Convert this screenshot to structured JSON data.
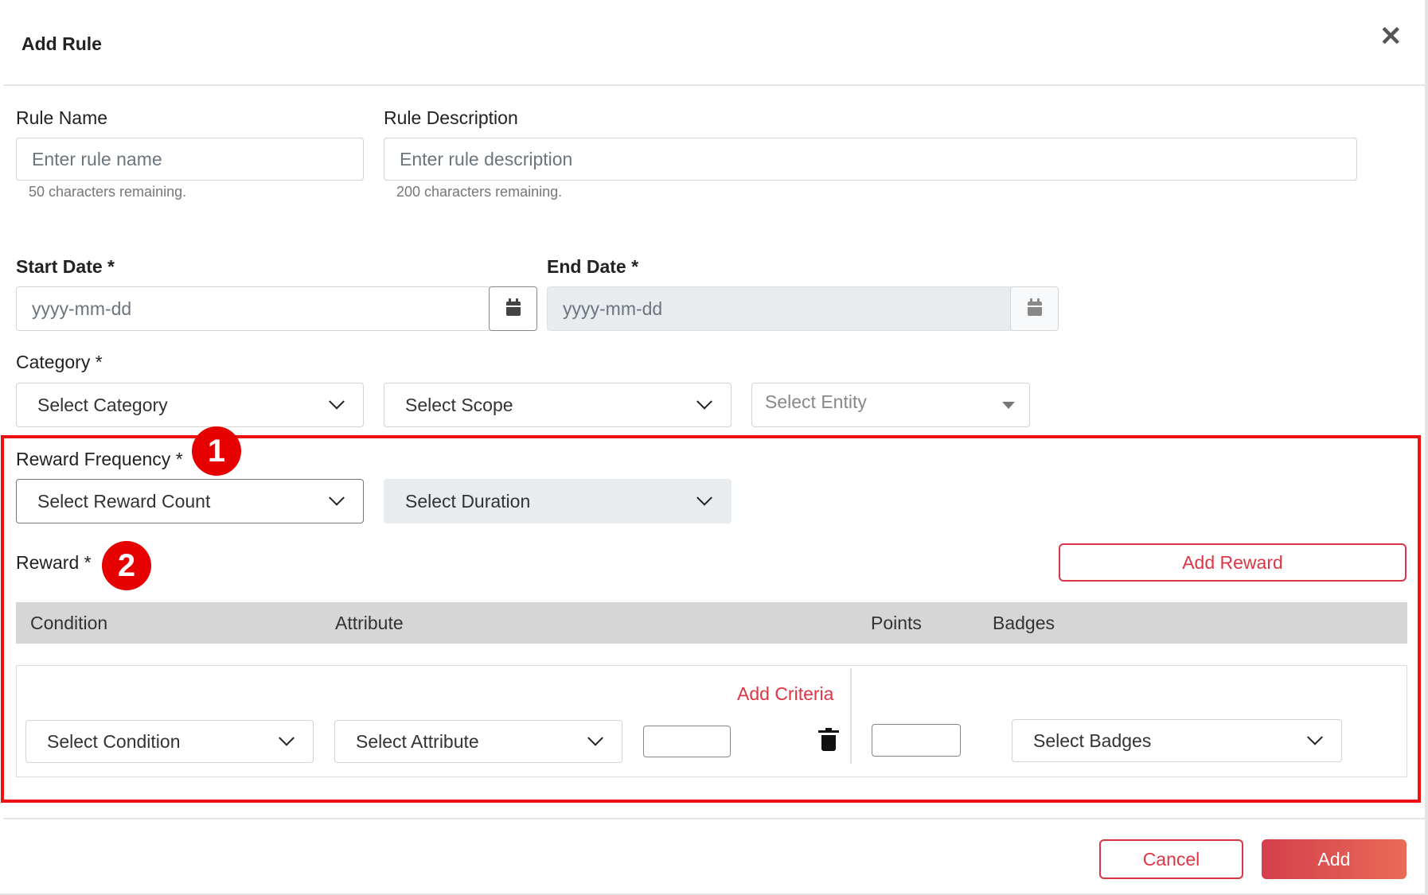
{
  "modal": {
    "title": "Add Rule"
  },
  "form": {
    "rule_name": {
      "label": "Rule Name",
      "placeholder": "Enter rule name",
      "hint": "50 characters remaining."
    },
    "rule_description": {
      "label": "Rule Description",
      "placeholder": "Enter rule description",
      "hint": "200 characters remaining."
    },
    "start_date": {
      "label": "Start Date *",
      "placeholder": "yyyy-mm-dd"
    },
    "end_date": {
      "label": "End Date *",
      "placeholder": "yyyy-mm-dd"
    },
    "category": {
      "label": "Category *",
      "category_select": "Select Category",
      "scope_select": "Select Scope",
      "entity_select": "Select Entity"
    },
    "reward_frequency": {
      "label": "Reward Frequency *",
      "count_select": "Select Reward Count",
      "duration_select": "Select Duration"
    },
    "reward": {
      "label": "Reward *",
      "add_button": "Add Reward",
      "columns": [
        "Condition",
        "Attribute",
        "Points",
        "Badges"
      ],
      "row": {
        "add_criteria": "Add Criteria",
        "condition_select": "Select Condition",
        "attribute_select": "Select Attribute",
        "badges_select": "Select Badges"
      }
    }
  },
  "annotations": {
    "marker_1": "1",
    "marker_2": "2",
    "highlight_color": "#ee1111"
  },
  "footer": {
    "cancel_label": "Cancel",
    "add_label": "Add"
  },
  "colors": {
    "accent": "#dc3545",
    "primary_gradient_start": "#d43f4b",
    "primary_gradient_end": "#e96b57"
  }
}
